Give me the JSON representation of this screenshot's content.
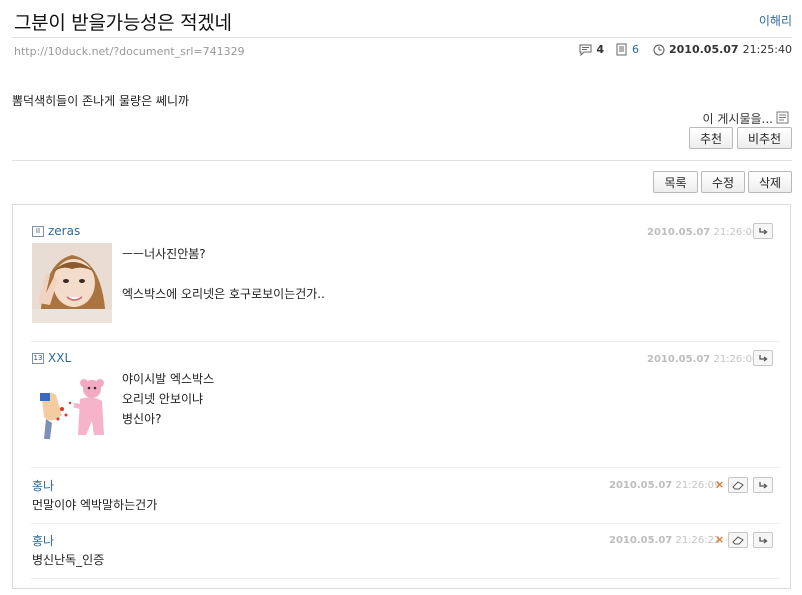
{
  "post": {
    "title": "그분이 받을가능성은 적겠네",
    "author": "이해리",
    "url": "http://10duck.net/?document_srl=741329",
    "comment_count": "4",
    "read_count": "6",
    "date": "2010.05.07",
    "time": "21:25:40",
    "body": "뽐덕색히들이 존나게 물량은 쎄니까"
  },
  "vote": {
    "label": "이 게시물을...",
    "recommend": "추천",
    "unrecommend": "비추천"
  },
  "actions": {
    "list": "목록",
    "edit": "수정",
    "delete": "삭제"
  },
  "comments": [
    {
      "author": "zeras",
      "level": "II",
      "date": "2010.05.07",
      "time": "21:26:00",
      "lines": [
        "ㅡㅡ너사진안봄?",
        "",
        "엑스박스에 오리넷은 호구로보이는건가.."
      ]
    },
    {
      "author": "XXL",
      "level": "13",
      "date": "2010.05.07",
      "time": "21:26:00",
      "lines": [
        "야이시발 엑스박스",
        "오리넷 안보이냐",
        "병신아?"
      ]
    },
    {
      "author": "홍나",
      "date": "2010.05.07",
      "time": "21:26:09",
      "lines": [
        "먼말이야 엑박말하는건가"
      ]
    },
    {
      "author": "홍나",
      "date": "2010.05.07",
      "time": "21:26:22",
      "lines": [
        "병신난독_인증"
      ]
    }
  ]
}
